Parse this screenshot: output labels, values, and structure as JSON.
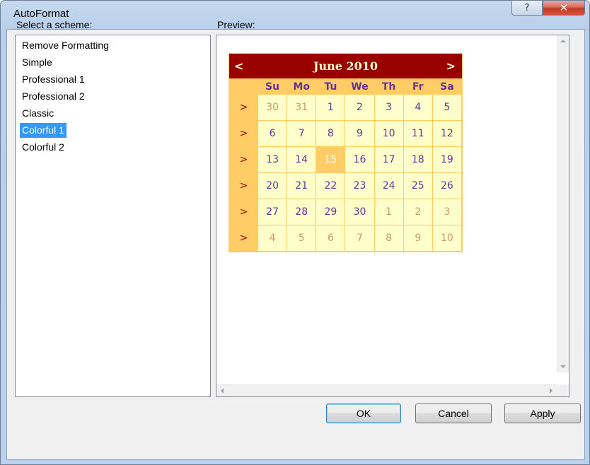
{
  "window": {
    "title": "AutoFormat",
    "help_glyph": "?",
    "close_glyph": "✕"
  },
  "labels": {
    "scheme": "Select a scheme:",
    "preview": "Preview:"
  },
  "schemes": [
    {
      "label": "Remove Formatting"
    },
    {
      "label": "Simple"
    },
    {
      "label": "Professional 1"
    },
    {
      "label": "Professional 2"
    },
    {
      "label": "Classic"
    },
    {
      "label": "Colorful 1",
      "selected": true
    },
    {
      "label": "Colorful 2"
    }
  ],
  "calendar": {
    "month": "June 2010",
    "prev": "<",
    "next": ">",
    "week_selector": ">",
    "days_of_week": [
      "Su",
      "Mo",
      "Tu",
      "We",
      "Th",
      "Fr",
      "Sa"
    ],
    "weeks": [
      [
        {
          "d": "30",
          "other": true
        },
        {
          "d": "31",
          "other": true
        },
        {
          "d": "1"
        },
        {
          "d": "2"
        },
        {
          "d": "3"
        },
        {
          "d": "4"
        },
        {
          "d": "5"
        }
      ],
      [
        {
          "d": "6"
        },
        {
          "d": "7"
        },
        {
          "d": "8"
        },
        {
          "d": "9"
        },
        {
          "d": "10"
        },
        {
          "d": "11"
        },
        {
          "d": "12"
        }
      ],
      [
        {
          "d": "13"
        },
        {
          "d": "14"
        },
        {
          "d": "15",
          "today": true
        },
        {
          "d": "16"
        },
        {
          "d": "17"
        },
        {
          "d": "18"
        },
        {
          "d": "19"
        }
      ],
      [
        {
          "d": "20"
        },
        {
          "d": "21"
        },
        {
          "d": "22"
        },
        {
          "d": "23"
        },
        {
          "d": "24"
        },
        {
          "d": "25"
        },
        {
          "d": "26"
        }
      ],
      [
        {
          "d": "27"
        },
        {
          "d": "28"
        },
        {
          "d": "29"
        },
        {
          "d": "30"
        },
        {
          "d": "1",
          "other": true
        },
        {
          "d": "2",
          "other": true
        },
        {
          "d": "3",
          "other": true
        }
      ],
      [
        {
          "d": "4",
          "other": true
        },
        {
          "d": "5",
          "other": true
        },
        {
          "d": "6",
          "other": true
        },
        {
          "d": "7",
          "other": true
        },
        {
          "d": "8",
          "other": true
        },
        {
          "d": "9",
          "other": true
        },
        {
          "d": "10",
          "other": true
        }
      ]
    ],
    "colors": {
      "title_bg": "#990000",
      "title_fg": "#ffffcc",
      "header_bg": "#ffcc66",
      "header_fg": "#663399",
      "day_bg": "#ffffcc",
      "other_month_fg": "#cc9966",
      "today_bg": "#ffcc66"
    }
  },
  "buttons": {
    "ok": "OK",
    "cancel": "Cancel",
    "apply": "Apply"
  }
}
